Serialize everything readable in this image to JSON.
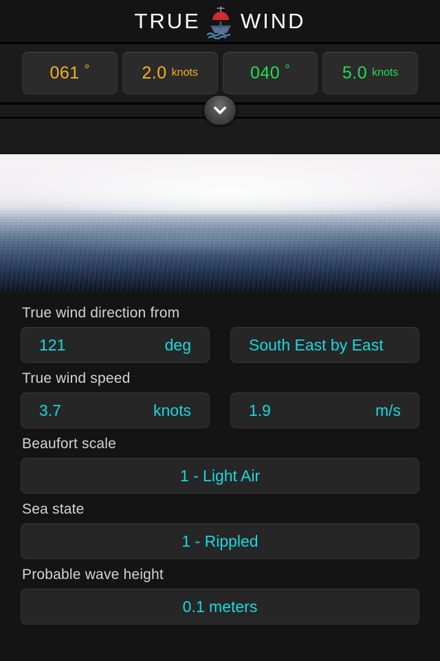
{
  "header": {
    "brand_left": "TRUE",
    "brand_right": "WIND",
    "logo_icon": "ship-icon"
  },
  "readouts": {
    "items": [
      {
        "value": "061",
        "unit": "°",
        "unit_is_degree": true,
        "color": "#f5b317",
        "name": "apparent-wind-direction"
      },
      {
        "value": "2.0",
        "unit": "knots",
        "unit_is_degree": false,
        "color": "#f5b317",
        "name": "apparent-wind-speed"
      },
      {
        "value": "040",
        "unit": "°",
        "unit_is_degree": true,
        "color": "#22dd55",
        "name": "heading"
      },
      {
        "value": "5.0",
        "unit": "knots",
        "unit_is_degree": false,
        "color": "#22dd55",
        "name": "boat-speed"
      }
    ]
  },
  "disclosure": {
    "icon": "chevron-down-icon",
    "aria_label": "Expand input panel"
  },
  "hero": {
    "image_alt": "calm open sea with hazy horizon"
  },
  "details": {
    "direction": {
      "label": "True wind direction from",
      "degrees_value": "121",
      "degrees_unit": "deg",
      "compass_point": "South East by East"
    },
    "speed": {
      "label": "True wind speed",
      "knots_value": "3.7",
      "knots_unit": "knots",
      "ms_value": "1.9",
      "ms_unit": "m/s"
    },
    "beaufort": {
      "label": "Beaufort scale",
      "value": "1 - Light Air"
    },
    "sea_state": {
      "label": "Sea state",
      "value": "1 - Rippled"
    },
    "wave_height": {
      "label": "Probable wave height",
      "value": "0.1 meters"
    }
  },
  "colors": {
    "amber": "#f5b317",
    "green": "#22dd55",
    "cyan": "#17d9e0",
    "label_gray": "#d4d4d4",
    "panel_bg": "#141414",
    "box_bg": "#262626"
  }
}
